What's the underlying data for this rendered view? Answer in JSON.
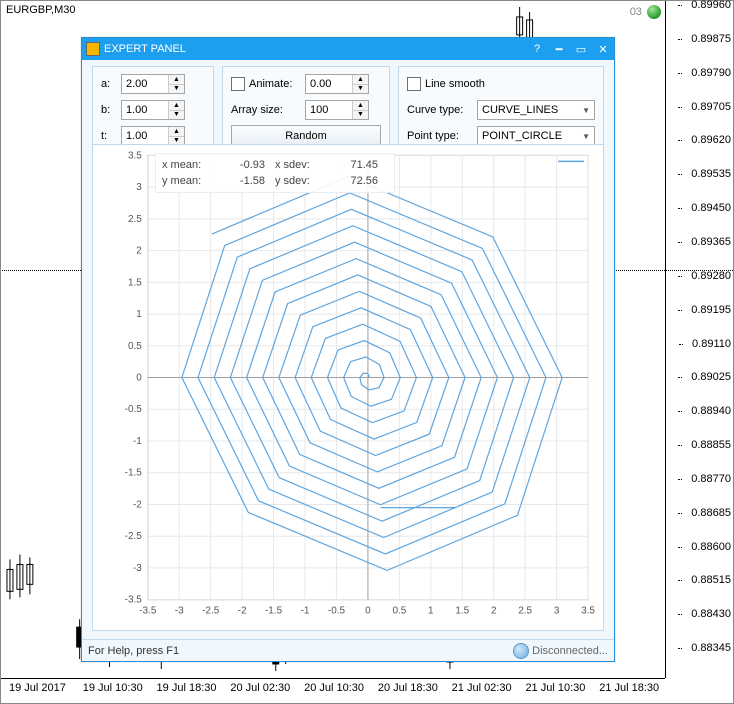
{
  "symbol": "EURGBP,M30",
  "top_badge": "03",
  "price_axis": [
    "0.89960",
    "0.89875",
    "0.89790",
    "0.89705",
    "0.89620",
    "0.89535",
    "0.89450",
    "0.89365",
    "0.89280",
    "0.89195",
    "0.89110",
    "0.89025",
    "0.88940",
    "0.88855",
    "0.88770",
    "0.88685",
    "0.88600",
    "0.88515",
    "0.88430",
    "0.88345"
  ],
  "time_axis": [
    "19 Jul 2017",
    "19 Jul 10:30",
    "19 Jul 18:30",
    "20 Jul 02:30",
    "20 Jul 10:30",
    "20 Jul 18:30",
    "21 Jul 02:30",
    "21 Jul 10:30",
    "21 Jul 18:30"
  ],
  "panel": {
    "title": "EXPERT PANEL",
    "params": {
      "a": {
        "label": "a:",
        "value": "2.00"
      },
      "b": {
        "label": "b:",
        "value": "1.00"
      },
      "t": {
        "label": "t:",
        "value": "1.00"
      }
    },
    "animate": {
      "label": "Animate:",
      "value": "0.00"
    },
    "array_size": {
      "label": "Array size:",
      "value": "100"
    },
    "random_label": "Random",
    "line_smooth_label": "Line smooth",
    "curve_type": {
      "label": "Curve type:",
      "value": "CURVE_LINES"
    },
    "point_type": {
      "label": "Point type:",
      "value": "POINT_CIRCLE"
    },
    "stats": {
      "xmean_l": "x mean:",
      "xmean_v": "-0.93",
      "xsdev_l": "x sdev:",
      "xsdev_v": "71.45",
      "ymean_l": "y mean:",
      "ymean_v": "-1.58",
      "ysdev_l": "y sdev:",
      "ysdev_v": "72.56"
    },
    "help_text": "For Help, press F1",
    "conn_text": "Disconnected..."
  },
  "chart_data": {
    "type": "line",
    "title": "",
    "xlabel": "",
    "ylabel": "",
    "xlim": [
      -3.5,
      3.5
    ],
    "ylim": [
      -3.5,
      3.5
    ],
    "xticks": [
      -3.5,
      -3,
      -2.5,
      -2,
      -1.5,
      -1,
      -0.5,
      0,
      0.5,
      1,
      1.5,
      2,
      2.5,
      3,
      3.5
    ],
    "yticks": [
      -3.5,
      -3,
      -2.5,
      -2,
      -1.5,
      -1,
      -0.5,
      0,
      0.5,
      1,
      1.5,
      2,
      2.5,
      3,
      3.5
    ],
    "spiral": {
      "a": 2.0,
      "b": 1.0,
      "t": 1.0,
      "n_points": 100,
      "r_max": 3.2,
      "theta_step_deg": 45
    },
    "color": "#5da5e0"
  }
}
